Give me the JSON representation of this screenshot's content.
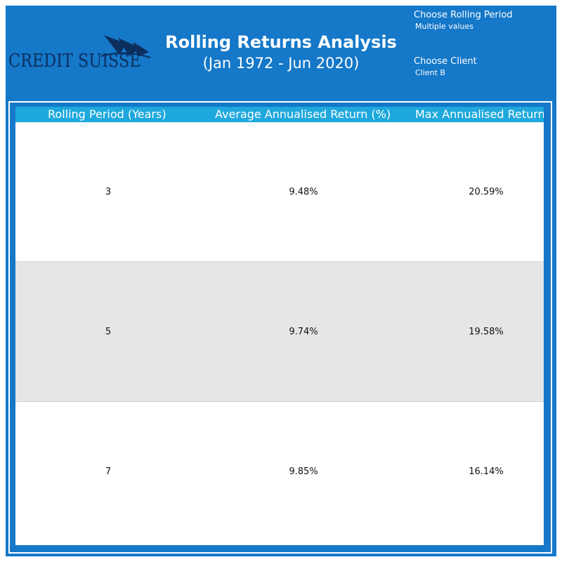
{
  "header": {
    "logo_text": "CREDIT SUISSE",
    "title": "Rolling Returns Analysis",
    "subtitle": "(Jan 1972 - Jun 2020)"
  },
  "filters": {
    "rolling_period": {
      "label": "Choose Rolling Period",
      "value": "Multiple values"
    },
    "client": {
      "label": "Choose Client",
      "value": "Client B"
    }
  },
  "table": {
    "columns": [
      "Rolling Period (Years)",
      "Average Annualised Return (%)",
      "Max Annualised Return"
    ],
    "rows": [
      [
        "3",
        "9.48%",
        "20.59%"
      ],
      [
        "5",
        "9.74%",
        "19.58%"
      ],
      [
        "7",
        "9.85%",
        "16.14%"
      ]
    ]
  },
  "colors": {
    "background": "#1578c9",
    "table_header": "#1ea8dd",
    "logo": "#0d2f5e",
    "alt_row": "#e6e6e6"
  }
}
